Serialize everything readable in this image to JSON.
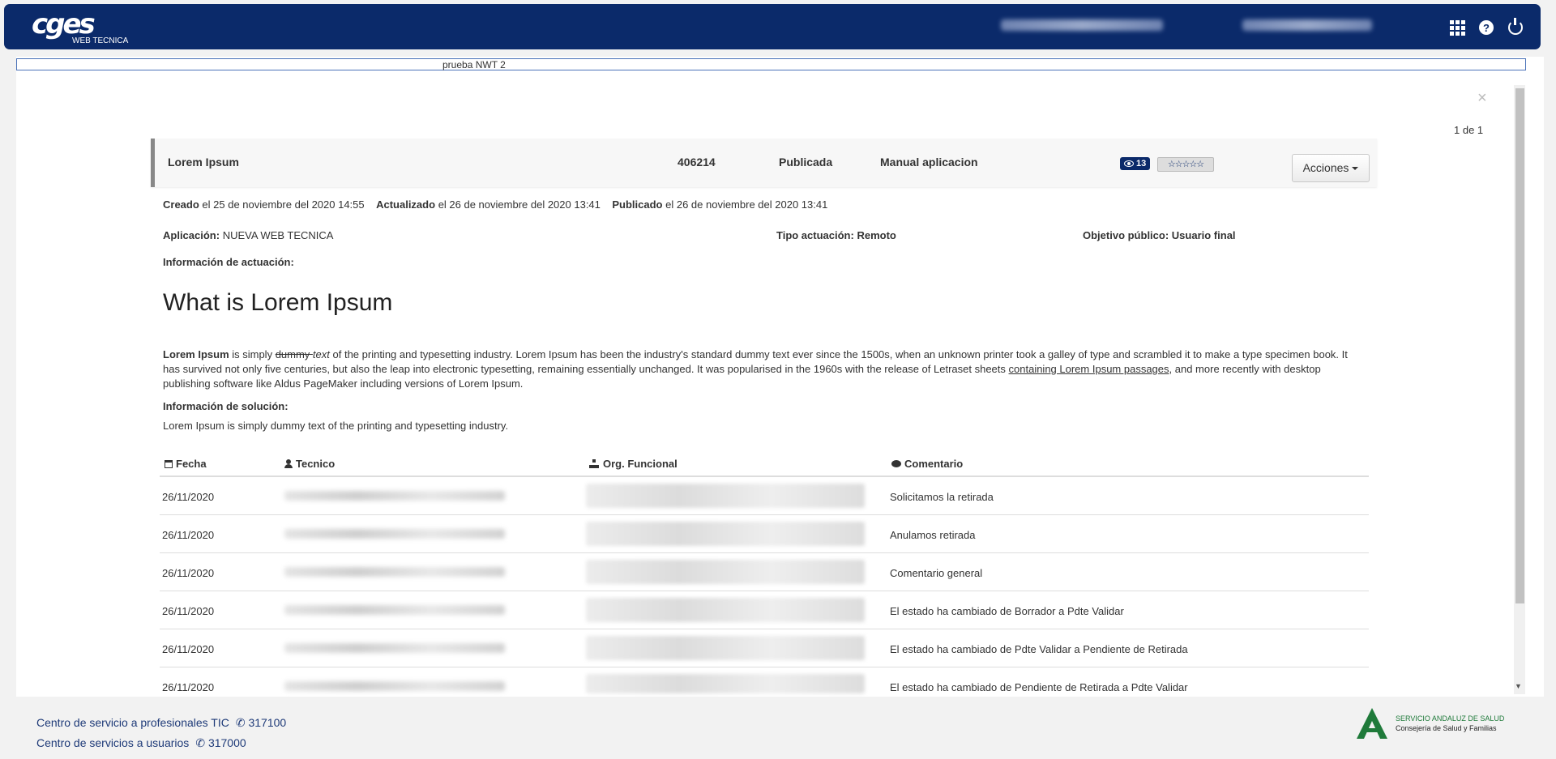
{
  "header": {
    "logo_text": "cges",
    "logo_subtitle": "WEB TECNICA"
  },
  "title_field": {
    "value": "prueba NWT 2"
  },
  "pager": "1 de 1",
  "ticket": {
    "name": "Lorem Ipsum",
    "id": "406214",
    "status": "Publicada",
    "type": "Manual aplicacion",
    "views": "13",
    "stars": "☆☆☆☆☆",
    "actions_label": "Acciones"
  },
  "meta": {
    "created_label": "Creado",
    "created_value": "el 25 de noviembre del 2020 14:55",
    "updated_label": "Actualizado",
    "updated_value": "el 26 de noviembre del 2020 13:41",
    "published_label": "Publicado",
    "published_value": "el 26 de noviembre del 2020 13:41"
  },
  "details": {
    "app_label": "Aplicación:",
    "app_value": "NUEVA WEB TECNICA",
    "tipo_label": "Tipo actuación:",
    "tipo_value": "Remoto",
    "objetivo_label": "Objetivo público:",
    "objetivo_value": "Usuario final",
    "info_actuacion_label": "Información de actuación:"
  },
  "content": {
    "heading": "What is Lorem Ipsum",
    "p_bold": "Lorem Ipsum",
    "p_1": " is simply ",
    "p_strike": "dummy ",
    "p_italic": "text",
    "p_2": " of the printing and typesetting industry. Lorem Ipsum has been the industry's standard dummy text ever since the 1500s, when an unknown printer took a galley of type and scrambled it to make a type specimen book. It has survived not only five centuries, but also the leap into electronic typesetting, remaining essentially unchanged. It was popularised in the 1960s with the release of Letraset sheets ",
    "p_link": "containing Lorem Ipsum passages",
    "p_3": ", and more recently with desktop publishing software like Aldus PageMaker including versions of Lorem Ipsum.",
    "solution_label": "Información de solución:",
    "solution_text": "Lorem Ipsum is simply dummy text of the printing and typesetting industry."
  },
  "history": {
    "headers": {
      "fecha": "Fecha",
      "tecnico": "Tecnico",
      "org": "Org. Funcional",
      "comentario": "Comentario"
    },
    "rows": [
      {
        "fecha": "26/11/2020",
        "comentario": "Solicitamos la retirada"
      },
      {
        "fecha": "26/11/2020",
        "comentario": "Anulamos retirada"
      },
      {
        "fecha": "26/11/2020",
        "comentario": "Comentario general"
      },
      {
        "fecha": "26/11/2020",
        "comentario": "El estado ha cambiado de Borrador a Pdte Validar"
      },
      {
        "fecha": "26/11/2020",
        "comentario": "El estado ha cambiado de Pdte Validar a Pendiente de Retirada"
      },
      {
        "fecha": "26/11/2020",
        "comentario": "El estado ha cambiado de Pendiente de Retirada a Pdte Validar"
      }
    ]
  },
  "footer": {
    "link1_text": "Centro de servicio a profesionales TIC",
    "link1_phone": "317100",
    "link2_text": "Centro de servicios a usuarios",
    "link2_phone": "317000",
    "sas_line1": "SERVICIO ANDALUZ DE SALUD",
    "sas_line2": "Consejería de Salud y Familias"
  }
}
